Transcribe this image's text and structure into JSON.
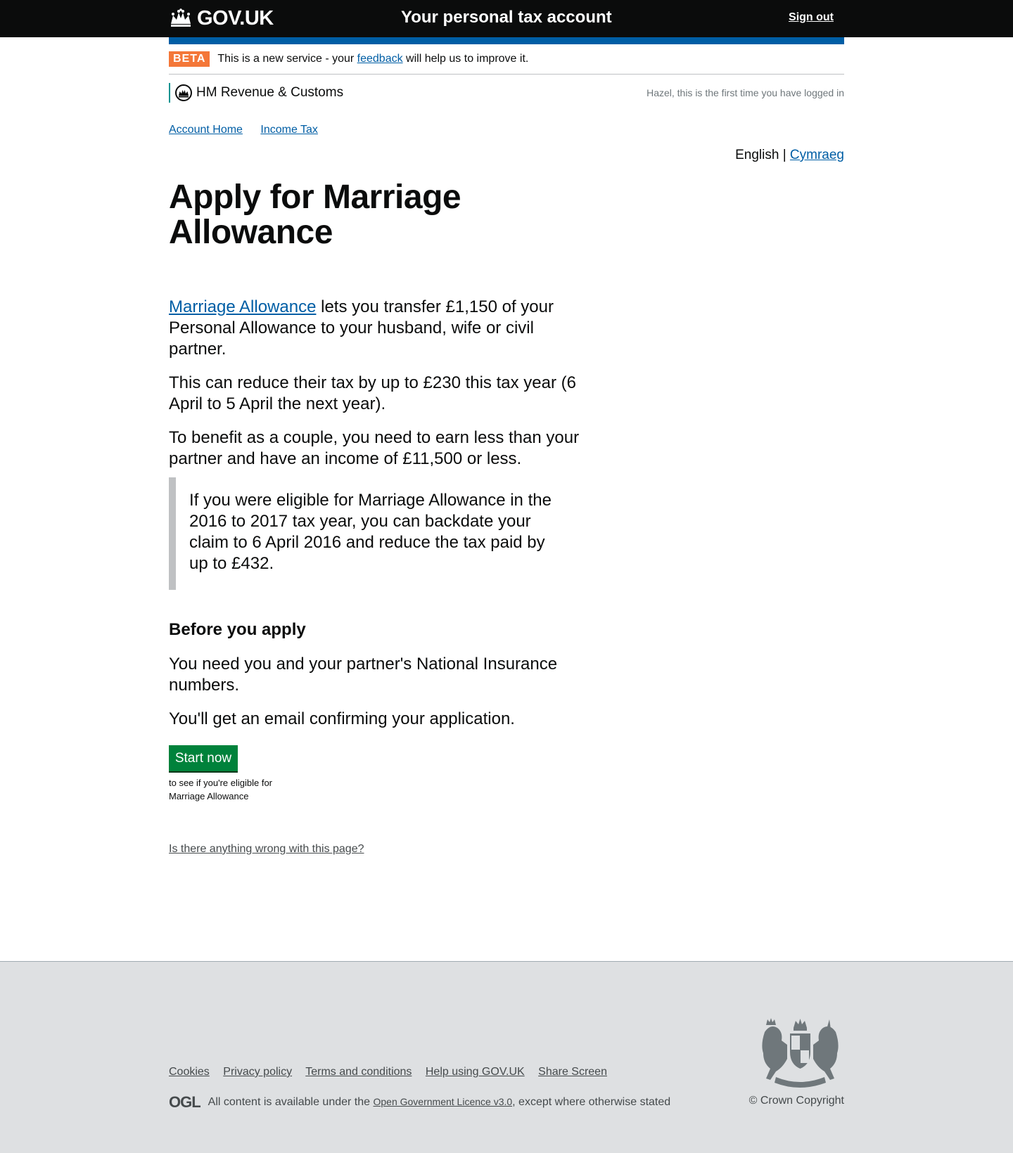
{
  "header": {
    "logo_text": "GOV.UK",
    "service_name": "Your personal tax account",
    "sign_out": "Sign out"
  },
  "beta_banner": {
    "tag": "BETA",
    "text_before": "This is a new service - your ",
    "link": "feedback",
    "text_after": " will help us to improve it."
  },
  "org": {
    "name": "HM Revenue & Customs",
    "login_note": "Hazel, this is the first time you have logged in"
  },
  "breadcrumbs": [
    "Account Home",
    "Income Tax"
  ],
  "language": {
    "current": "English",
    "separator": "|",
    "other": "Cymraeg"
  },
  "main": {
    "title": "Apply for Marriage Allowance",
    "intro_link": "Marriage Allowance",
    "intro_text": " lets you transfer £1,150 of your Personal Allowance to your husband, wife or civil partner.",
    "para2": "This can reduce their tax by up to £230 this tax year (6 April to 5 April the next year).",
    "para3": "To benefit as a couple, you need to earn less than your partner and have an income of £11,500 or less.",
    "inset": "If you were eligible for Marriage Allowance in the 2016 to 2017 tax year, you can backdate your claim to 6 April 2016 and reduce the tax paid by up to £432.",
    "before_heading": "Before you apply",
    "before_para1": "You need you and your partner's National Insurance numbers.",
    "before_para2": "You'll get an email confirming your application.",
    "start_button": "Start now",
    "start_hint": "to see if you're eligible for Marriage Allowance",
    "report_link": "Is there anything wrong with this page?"
  },
  "footer": {
    "links": [
      "Cookies",
      "Privacy policy",
      "Terms and conditions",
      "Help using GOV.UK",
      "Share Screen"
    ],
    "ogl_logo": "OGL",
    "licence_before": "All content is available under the ",
    "licence_link": "Open Government Licence v3.0",
    "licence_after": ", except where otherwise stated",
    "copyright": "© Crown Copyright"
  },
  "colors": {
    "header_bg": "#0b0c0c",
    "brand_blue": "#005ea5",
    "beta_orange": "#f47738",
    "button_green": "#00823b",
    "footer_bg": "#dee0e2",
    "hmrc_teal": "#009390"
  },
  "icons": [
    "crown-icon",
    "hmrc-crest-icon",
    "royal-arms-icon"
  ]
}
